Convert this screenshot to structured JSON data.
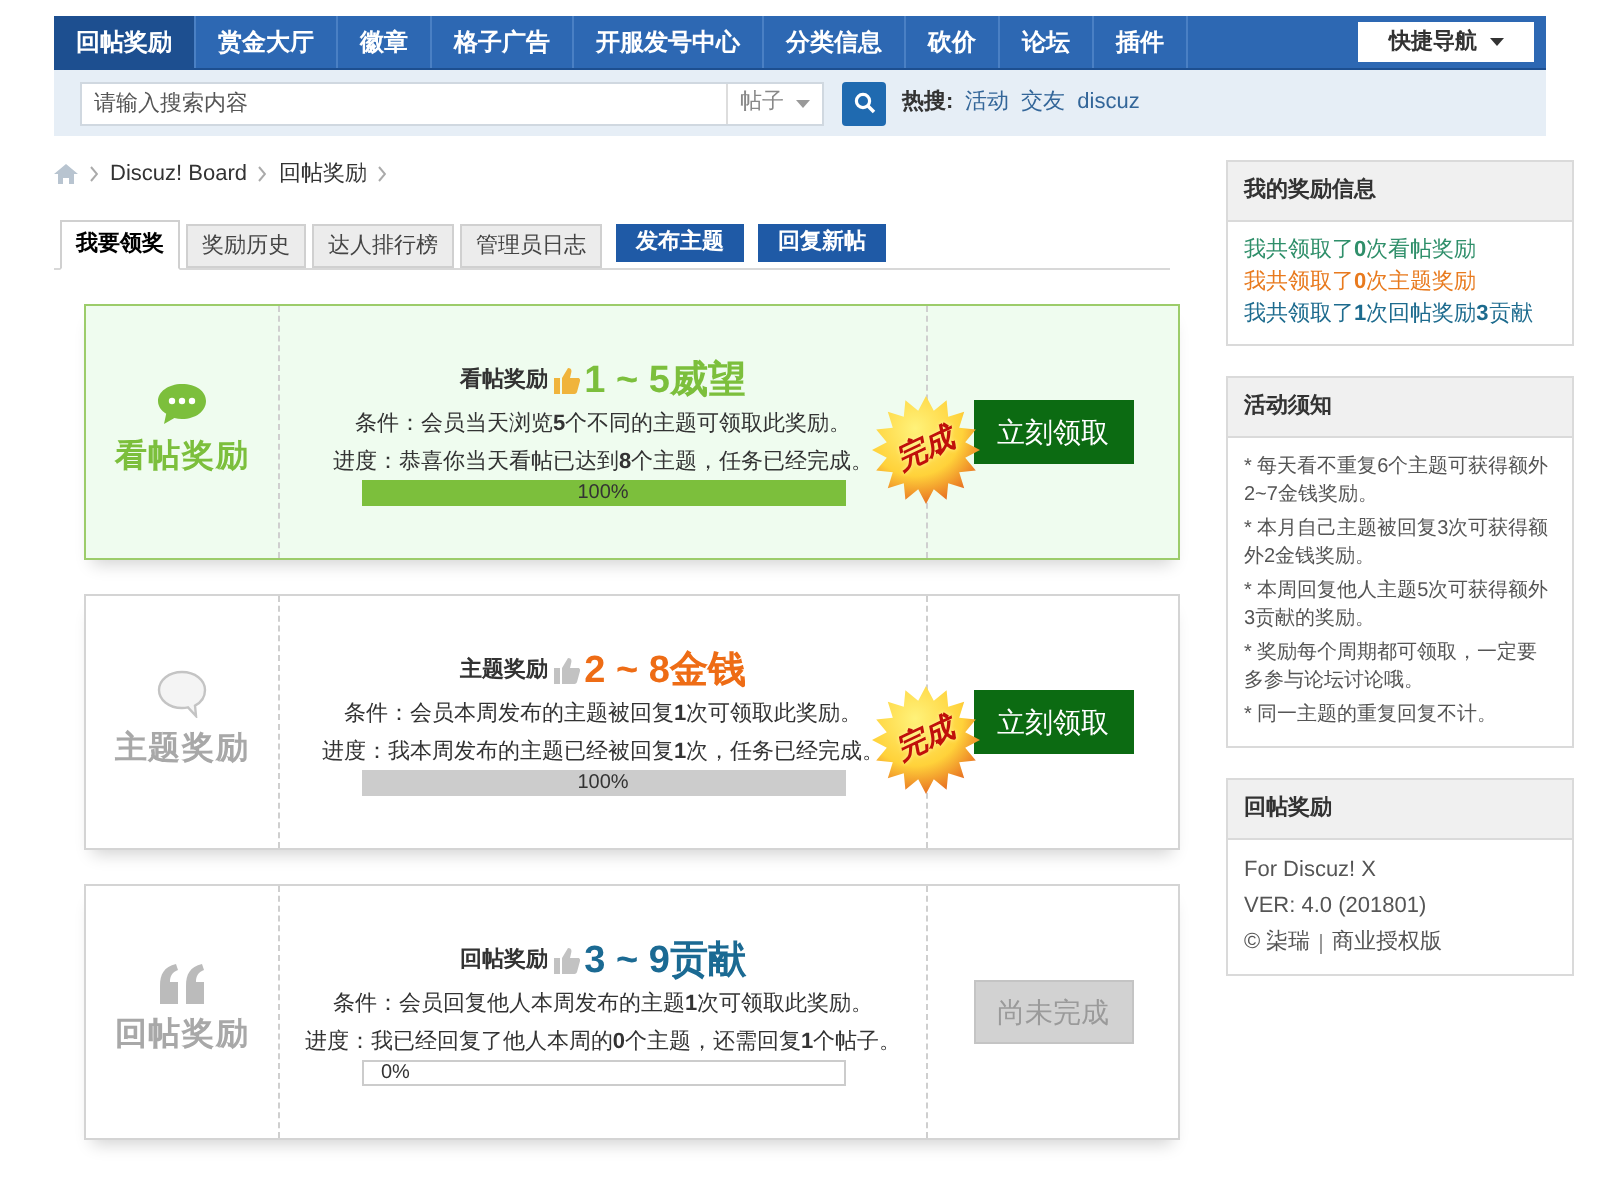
{
  "nav": {
    "items": [
      {
        "label": "回帖奖励",
        "selected": true
      },
      {
        "label": "赏金大厅",
        "selected": false
      },
      {
        "label": "徽章",
        "selected": false
      },
      {
        "label": "格子广告",
        "selected": false
      },
      {
        "label": "开服发号中心",
        "selected": false
      },
      {
        "label": "分类信息",
        "selected": false
      },
      {
        "label": "砍价",
        "selected": false
      },
      {
        "label": "论坛",
        "selected": false
      },
      {
        "label": "插件",
        "selected": false
      }
    ],
    "quick_nav": "快捷导航"
  },
  "search": {
    "placeholder": "请输入搜索内容",
    "scope": "帖子",
    "hot_label": "热搜:",
    "hot_tags": [
      "活动",
      "交友",
      "discuz"
    ]
  },
  "breadcrumb": [
    "Discuz! Board",
    "回帖奖励"
  ],
  "tabs": [
    {
      "label": "我要领奖",
      "kind": "tab",
      "selected": true
    },
    {
      "label": "奖励历史",
      "kind": "tab",
      "selected": false
    },
    {
      "label": "达人排行榜",
      "kind": "tab",
      "selected": false
    },
    {
      "label": "管理员日志",
      "kind": "tab",
      "selected": false
    },
    {
      "label": "发布主题",
      "kind": "button"
    },
    {
      "label": "回复新帖",
      "kind": "button"
    }
  ],
  "cards": [
    {
      "kind": "view",
      "highlighted": true,
      "name": "看帖奖励",
      "reward_label": "看帖奖励",
      "amount": "1 ~ 5威望",
      "color": "#7cbf3c",
      "condition": "条件：会员当天浏览**5**个不同的主题可领取此奖励。",
      "progress": "进度：恭喜你当天看帖已达到**8**个主题，任务已经完成。",
      "level": 1,
      "reading": "100%",
      "stamp": "完成",
      "button": "立刻领取",
      "disabled": false
    },
    {
      "kind": "topic",
      "highlighted": false,
      "name": "主题奖励",
      "reward_label": "主题奖励",
      "amount": "2 ~ 8金钱",
      "color": "#ee6c15",
      "condition": "条件：会员本周发布的主题被回复**1**次可领取此奖励。",
      "progress": "进度：我本周发布的主题已经被回复**1**次，任务已经完成。",
      "level": 1,
      "reading": "100%",
      "stamp": "完成",
      "button": "立刻领取",
      "disabled": false
    },
    {
      "kind": "reply",
      "highlighted": false,
      "name": "回帖奖励",
      "reward_label": "回帖奖励",
      "amount": "3 ~ 9贡献",
      "color": "#1b6a93",
      "condition": "条件：会员回复他人本周发布的主题**1**次可领取此奖励。",
      "progress": "进度：我已经回复了他人本周的**0**个主题，还需回复**1**个帖子。",
      "level": 0,
      "reading": "0%",
      "button": "尚未完成",
      "disabled": true
    }
  ],
  "sidebar": {
    "my_info": {
      "title": "我的奖励信息",
      "lines": [
        {
          "text": "我共领取了**0**次看帖奖励",
          "color": "#2f8f6a"
        },
        {
          "text": "我共领取了**0**次主题奖励",
          "color": "#e87a1e"
        },
        {
          "text": "我共领取了**1**次回帖奖励**3**贡献",
          "color": "#1d6b8e"
        }
      ]
    },
    "notice": {
      "title": "活动须知",
      "lines": [
        "* 每天看不重复6个主题可获得额外2~7金钱奖励。",
        "* 本月自己主题被回复3次可获得额外2金钱奖励。",
        "* 本周回复他人主题5次可获得额外3贡献的奖励。",
        "* 奖励每个周期都可领取，一定要多参与论坛讨论哦。",
        "* 同一主题的重复回复不计。"
      ]
    },
    "about": {
      "title": "回帖奖励",
      "lines": [
        "For Discuz! X",
        "VER: 4.0 (201801)"
      ],
      "copyright": "© 柒瑞",
      "license": "商业授权版"
    }
  }
}
